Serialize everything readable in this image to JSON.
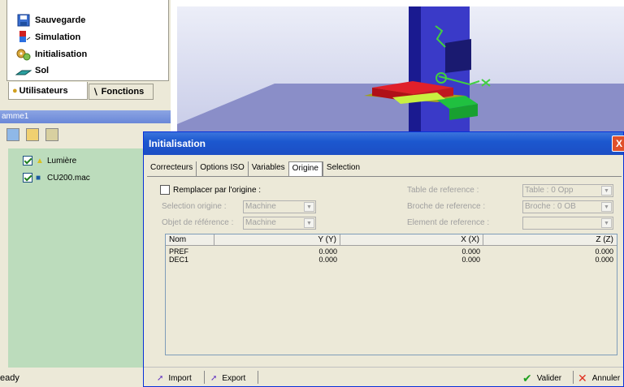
{
  "tree": {
    "items": [
      {
        "label": "Sauvegarde",
        "icon": "save-disk-icon"
      },
      {
        "label": "Simulation",
        "icon": "simulation-icon"
      },
      {
        "label": "Initialisation",
        "icon": "gears-icon"
      },
      {
        "label": "Sol",
        "icon": "floor-icon"
      }
    ]
  },
  "side_tabs": {
    "utilisateurs": "Utilisateurs",
    "fonctions": "Fonctions"
  },
  "panel_header": "amme1",
  "scene_items": [
    {
      "label": "Lumière",
      "checked": true
    },
    {
      "label": "CU200.mac",
      "checked": true
    }
  ],
  "status": "eady",
  "dialog": {
    "title": "Initialisation",
    "tabs": [
      "Correcteurs",
      "Options ISO",
      "Variables",
      "Origine",
      "Selection"
    ],
    "active_tab": "Origine",
    "replace_label": "Remplacer par l'origine :",
    "selection_origine_label": "Selection origine :",
    "selection_origine_value": "Machine",
    "objet_reference_label": "Objet de référence :",
    "objet_reference_value": "Machine",
    "table_reference_label": "Table de reference :",
    "table_reference_value": "Table : 0 Opp",
    "broche_reference_label": "Broche de reference :",
    "broche_reference_value": "Broche : 0 OB",
    "element_reference_label": "Element de reference :",
    "element_reference_value": "",
    "columns": [
      "Nom",
      "Y (Y)",
      "X (X)",
      "Z (Z)"
    ],
    "rows": [
      {
        "nom": "PREF",
        "y": "0.000",
        "x": "0.000",
        "z": "0.000"
      },
      {
        "nom": "DEC1",
        "y": "0.000",
        "x": "0.000",
        "z": "0.000"
      }
    ],
    "import_label": "Import",
    "export_label": "Export",
    "valider_label": "Valider",
    "annuler_label": "Annuler",
    "close_glyph": "X"
  },
  "colors": {
    "title_blue": "#1c58cf",
    "dialog_bg": "#ece9d8",
    "side_green": "#bcdcbc",
    "machine_blue": "#2a2ab8",
    "part_red": "#e0202a",
    "fixture_green": "#20c040"
  }
}
